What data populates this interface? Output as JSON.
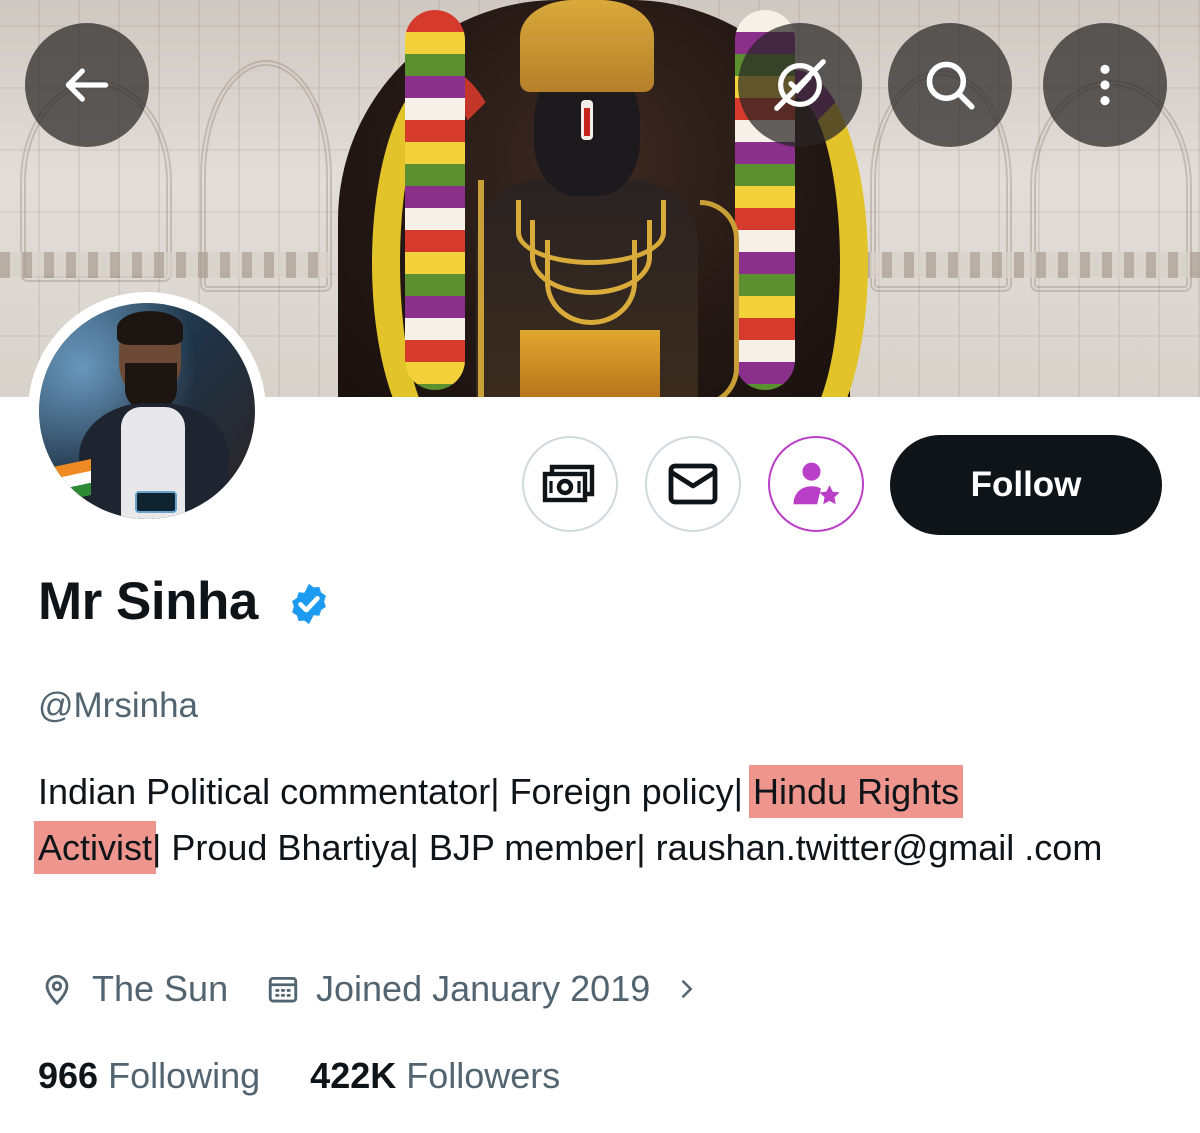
{
  "banner": {
    "back_icon": "arrow-left-icon",
    "subscribe_icon": "no-notifications-icon",
    "search_icon": "search-icon",
    "more_icon": "more-vertical-icon"
  },
  "profile": {
    "name": "Mr Sinha",
    "verified": true,
    "handle": "@Mrsinha",
    "bio_parts": {
      "p1": "Indian Political commentator| Foreign policy| ",
      "h1": "Hindu Rights",
      "p2": " ",
      "h2": "Activist",
      "p3": "| Proud Bhartiya| BJP member| raushan.twitter@gmail .com"
    },
    "location": "The Sun",
    "joined": "Joined January 2019",
    "following_count": "966",
    "following_label": "Following",
    "followers_count": "422K",
    "followers_label": "Followers"
  },
  "actions": {
    "follow_label": "Follow",
    "tip_icon": "money-icon",
    "message_icon": "envelope-icon",
    "subscribe_icon": "person-star-icon"
  },
  "colors": {
    "accent_dark": "#0f1419",
    "muted": "#536471",
    "verified_blue": "#1d9bf0",
    "subscribe_purple": "#b93fc6",
    "highlight": "#e86e62"
  }
}
